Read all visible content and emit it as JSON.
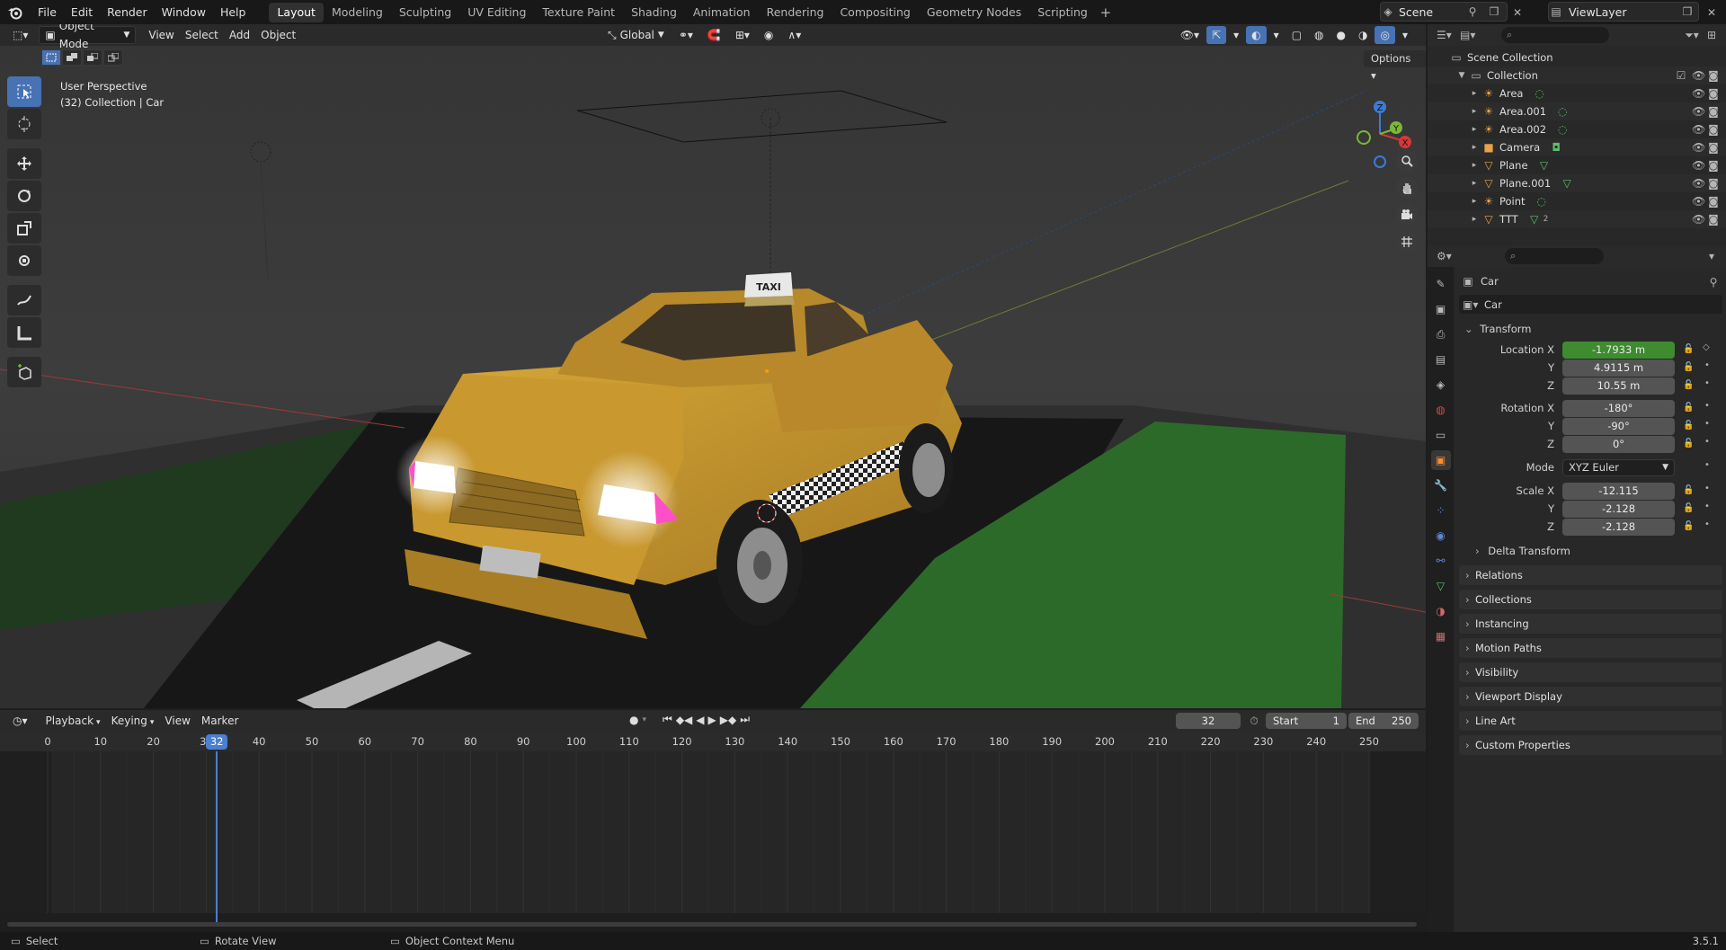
{
  "menu": [
    "File",
    "Edit",
    "Render",
    "Window",
    "Help"
  ],
  "workspaces": [
    {
      "label": "Layout",
      "active": true
    },
    {
      "label": "Modeling"
    },
    {
      "label": "Sculpting"
    },
    {
      "label": "UV Editing"
    },
    {
      "label": "Texture Paint"
    },
    {
      "label": "Shading"
    },
    {
      "label": "Animation"
    },
    {
      "label": "Rendering"
    },
    {
      "label": "Compositing"
    },
    {
      "label": "Geometry Nodes"
    },
    {
      "label": "Scripting"
    }
  ],
  "scene_name": "Scene",
  "view_layer": "ViewLayer",
  "viewport": {
    "mode": "Object Mode",
    "menus": [
      "View",
      "Select",
      "Add",
      "Object"
    ],
    "orientation": "Global",
    "options_label": "Options",
    "perspective_label": "User Perspective",
    "collection_label": "(32) Collection | Car",
    "taxi_sign": "TAXI",
    "axis_labels": {
      "z": "Z",
      "y": "Y",
      "x": "X"
    }
  },
  "outliner": {
    "root": "Scene Collection",
    "collection": "Collection",
    "items": [
      {
        "name": "Area",
        "icon": "light-icon"
      },
      {
        "name": "Area.001",
        "icon": "light-icon"
      },
      {
        "name": "Area.002",
        "icon": "light-icon"
      },
      {
        "name": "Camera",
        "icon": "camera-icon"
      },
      {
        "name": "Plane",
        "icon": "mesh-icon"
      },
      {
        "name": "Plane.001",
        "icon": "mesh-icon"
      },
      {
        "name": "Point",
        "icon": "light-icon"
      },
      {
        "name": "TTT",
        "icon": "mesh-icon",
        "badge": "2"
      }
    ]
  },
  "properties": {
    "object_name": "Car",
    "data_name": "Car",
    "transform_title": "Transform",
    "location": {
      "label": "Location X",
      "x": "-1.7933 m",
      "y": "4.9115 m",
      "z": "10.55 m"
    },
    "rotation": {
      "label": "Rotation X",
      "x": "-180°",
      "y": "-90°",
      "z": "0°"
    },
    "mode": {
      "label": "Mode",
      "value": "XYZ Euler"
    },
    "scale": {
      "label": "Scale X",
      "x": "-12.115",
      "y": "-2.128",
      "z": "-2.128"
    },
    "axis_y": "Y",
    "axis_z": "Z",
    "delta": "Delta Transform",
    "panels": [
      "Relations",
      "Collections",
      "Instancing",
      "Motion Paths",
      "Visibility",
      "Viewport Display",
      "Line Art",
      "Custom Properties"
    ]
  },
  "timeline": {
    "menus": [
      "Playback",
      "Keying",
      "View",
      "Marker"
    ],
    "current_frame": "32",
    "start_label": "Start",
    "start": "1",
    "end_label": "End",
    "end": "250",
    "ticks": [
      "0",
      "10",
      "20",
      "30",
      "40",
      "50",
      "60",
      "70",
      "80",
      "90",
      "100",
      "110",
      "120",
      "130",
      "140",
      "150",
      "160",
      "170",
      "180",
      "190",
      "200",
      "210",
      "220",
      "230",
      "240",
      "250"
    ]
  },
  "status": {
    "select": "Select",
    "rotate": "Rotate View",
    "context": "Object Context Menu",
    "version": "3.5.1"
  }
}
